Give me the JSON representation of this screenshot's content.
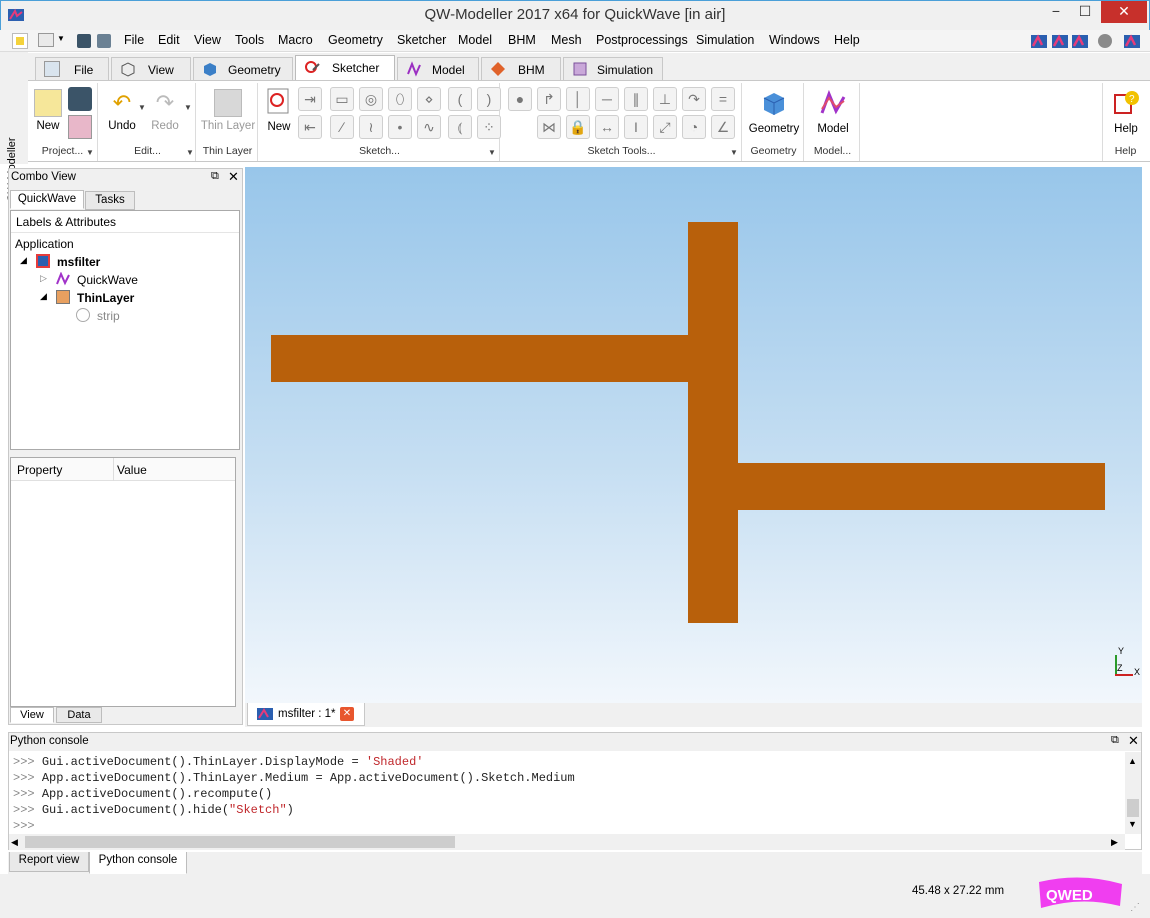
{
  "window": {
    "title": "QW-Modeller 2017 x64 for QuickWave [in air]",
    "minimize_glyph": "−",
    "maximize_glyph": "☐",
    "close_glyph": "✕"
  },
  "menubar": {
    "items": [
      "File",
      "Edit",
      "View",
      "Tools",
      "Macro",
      "Geometry",
      "Sketcher",
      "Model",
      "BHM",
      "Mesh",
      "Postprocessings",
      "Simulation",
      "Windows",
      "Help"
    ]
  },
  "ribbon_tabs": [
    {
      "label": "File",
      "icon": "file-tab-icon"
    },
    {
      "label": "View",
      "icon": "view-cube-icon"
    },
    {
      "label": "Geometry",
      "icon": "geometry-cube-icon"
    },
    {
      "label": "Sketcher",
      "icon": "sketcher-icon",
      "active": true
    },
    {
      "label": "Model",
      "icon": "model-icon"
    },
    {
      "label": "BHM",
      "icon": "bhm-icon"
    },
    {
      "label": "Simulation",
      "icon": "simulation-icon"
    }
  ],
  "side_label": "QW-Modeller",
  "ribbon": {
    "project": {
      "new_label": "New",
      "group_label": "Project..."
    },
    "edit": {
      "undo_label": "Undo",
      "redo_label": "Redo",
      "group_label": "Edit..."
    },
    "thin_layer": {
      "button_label": "Thin Layer",
      "group_label": "Thin Layer"
    },
    "sketch": {
      "new_label": "New",
      "group_label": "Sketch..."
    },
    "sketch_tools": {
      "group_label": "Sketch Tools..."
    },
    "geometry": {
      "button_label": "Geometry",
      "group_label": "Geometry"
    },
    "model": {
      "button_label": "Model",
      "group_label": "Model..."
    },
    "help": {
      "button_label": "Help",
      "group_label": "Help"
    }
  },
  "combo_view": {
    "title": "Combo View",
    "tabs": [
      "QuickWave",
      "Tasks"
    ],
    "tree_header": "Labels & Attributes",
    "tree": {
      "root": "Application",
      "doc": "msfilter",
      "child1": "QuickWave",
      "child2": "ThinLayer",
      "child3": "strip"
    },
    "props_headers": [
      "Property",
      "Value"
    ],
    "bottom_tabs": [
      "View",
      "Data"
    ]
  },
  "document_tab": {
    "label": "msfilter : 1*"
  },
  "axis": {
    "y": "Y",
    "z": "Z",
    "x": "X"
  },
  "console": {
    "title": "Python console",
    "prompt": ">>>",
    "lines": [
      {
        "code": "Gui.activeDocument().ThinLayer.DisplayMode = ",
        "str": "'Shaded'"
      },
      {
        "code": "App.activeDocument().ThinLayer.Medium = App.activeDocument().Sketch.Medium",
        "str": ""
      },
      {
        "code": "App.activeDocument().recompute()",
        "str": ""
      },
      {
        "code": "Gui.activeDocument().hide(",
        "str": "\"Sketch\"",
        "tail": ")"
      },
      {
        "code": "",
        "str": ""
      }
    ]
  },
  "bottom_tabs": [
    "Report view",
    "Python console"
  ],
  "status": {
    "dimensions": "45.48 x 27.22 mm",
    "logo": "QWED"
  },
  "colors": {
    "strip": "#b8600b",
    "viewport_top": "#98c6ea",
    "viewport_bottom": "#f2f7fc",
    "accent": "#e81123"
  }
}
